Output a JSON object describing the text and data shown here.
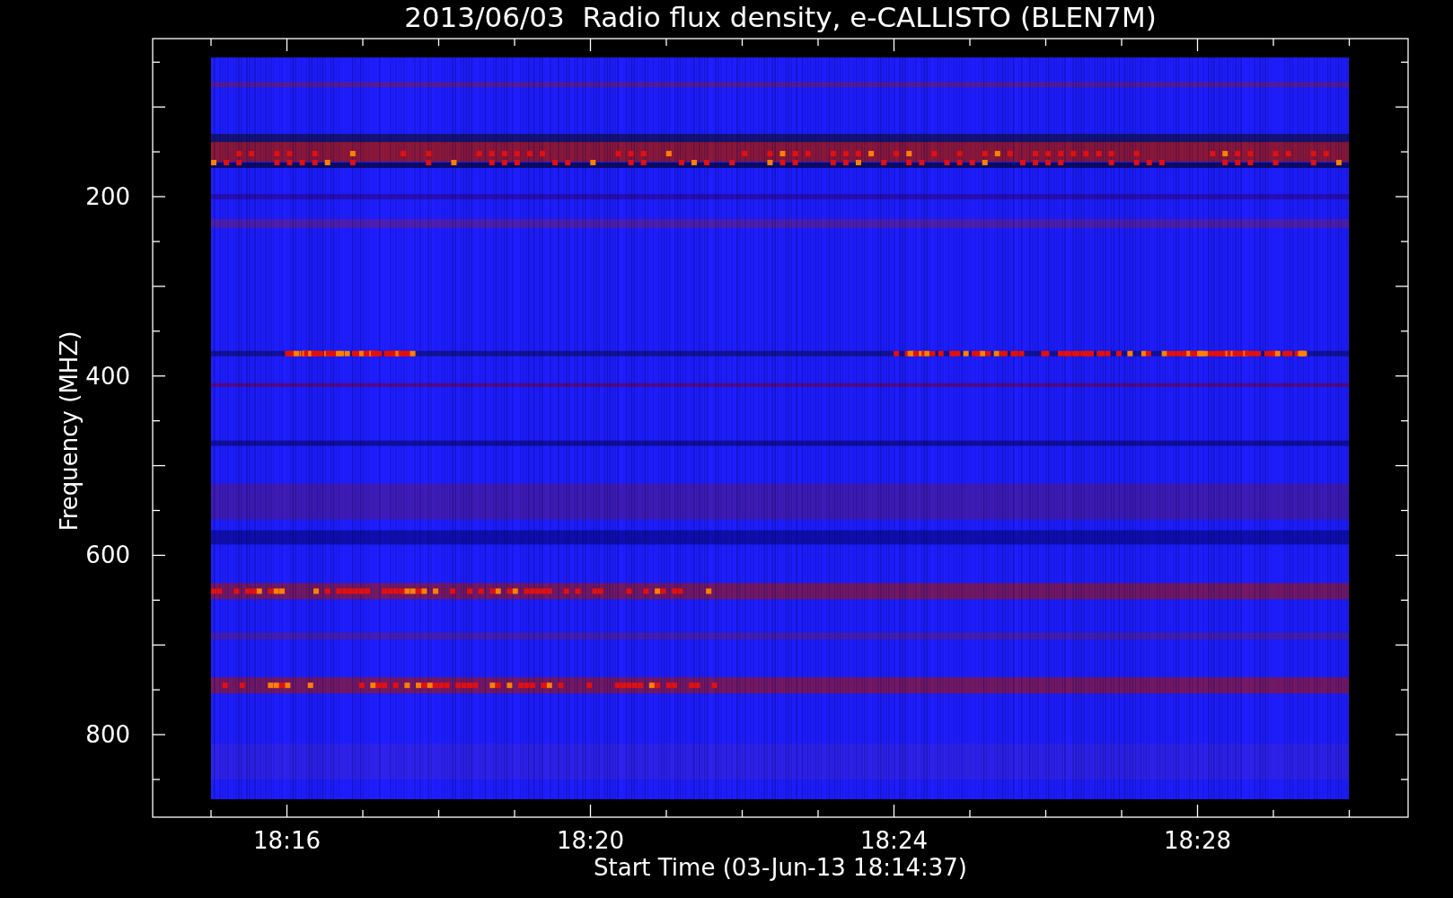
{
  "title": "2013/06/03  Radio flux density, e-CALLISTO (BLEN7M)",
  "xlabel": "Start Time (03-Jun-13 18:14:37)",
  "ylabel": "Frequency (MHZ)",
  "xtick_labels": [
    "18:16",
    "18:20",
    "18:24",
    "18:28"
  ],
  "ytick_labels": [
    "200",
    "400",
    "600",
    "800"
  ]
}
